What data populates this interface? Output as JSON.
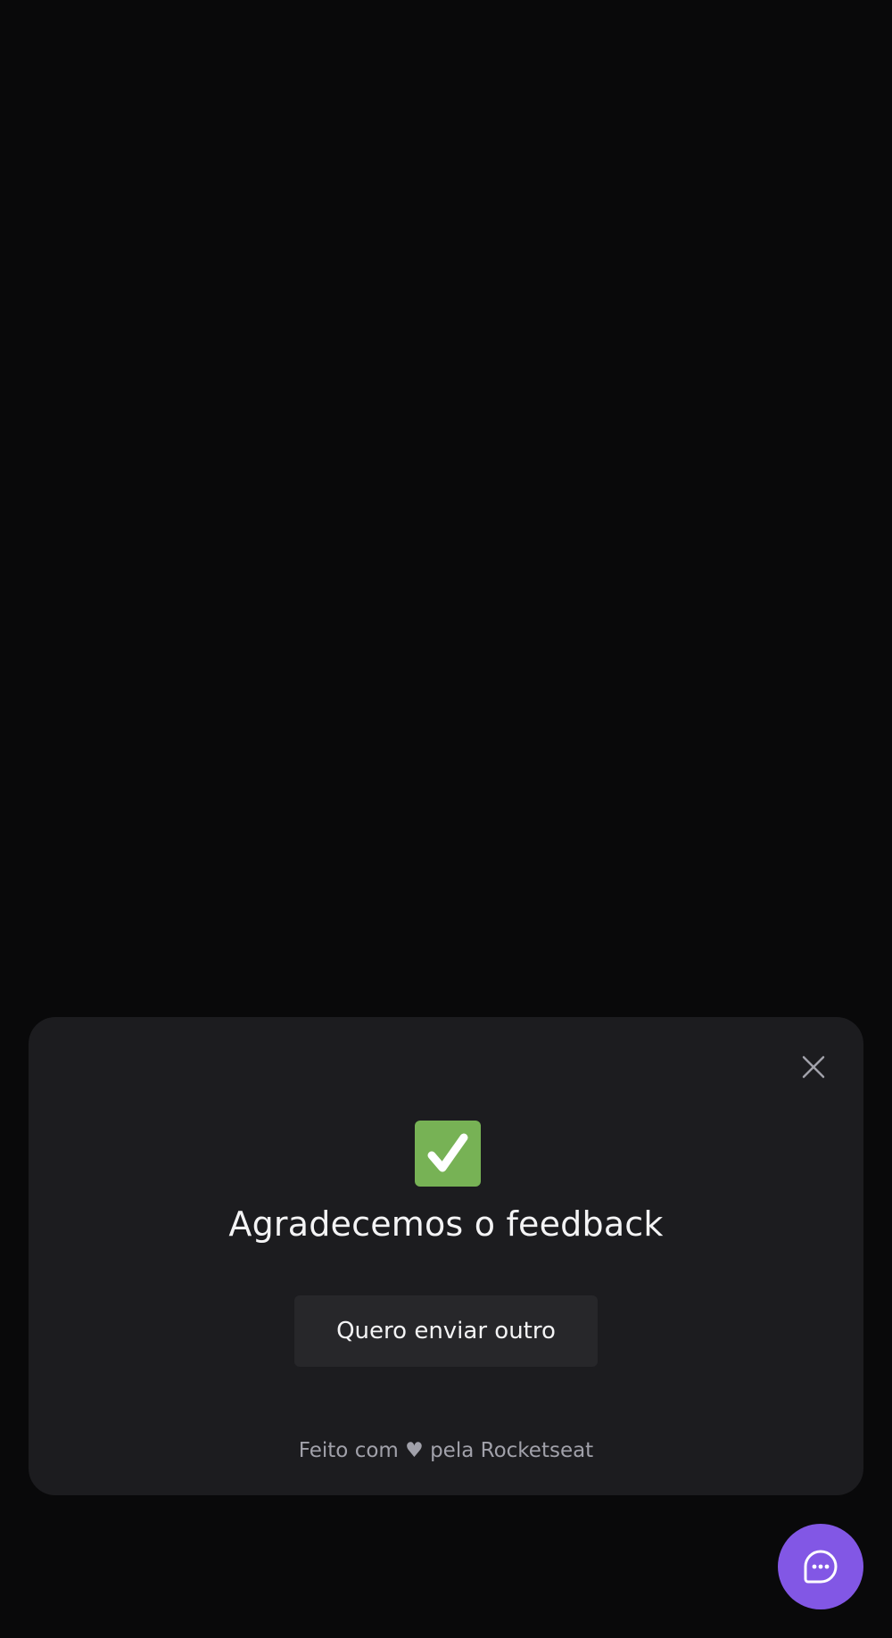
{
  "widget": {
    "success_icon": "check-mark-button-icon",
    "title": "Agradecemos o feedback",
    "again_button_label": "Quero enviar outro",
    "footer": {
      "prefix": "Feito com",
      "heart": "♥",
      "suffix": "pela Rocketseat"
    },
    "close_icon": "close-icon"
  },
  "launcher": {
    "icon": "chat-teardrop-dots-icon"
  },
  "colors": {
    "background": "#09090a",
    "card": "#1c1c1f",
    "button": "#27272a",
    "brand": "#8257e5",
    "success": "#77b255",
    "text_primary": "#f4f4f5",
    "text_secondary": "#a1a1aa"
  }
}
